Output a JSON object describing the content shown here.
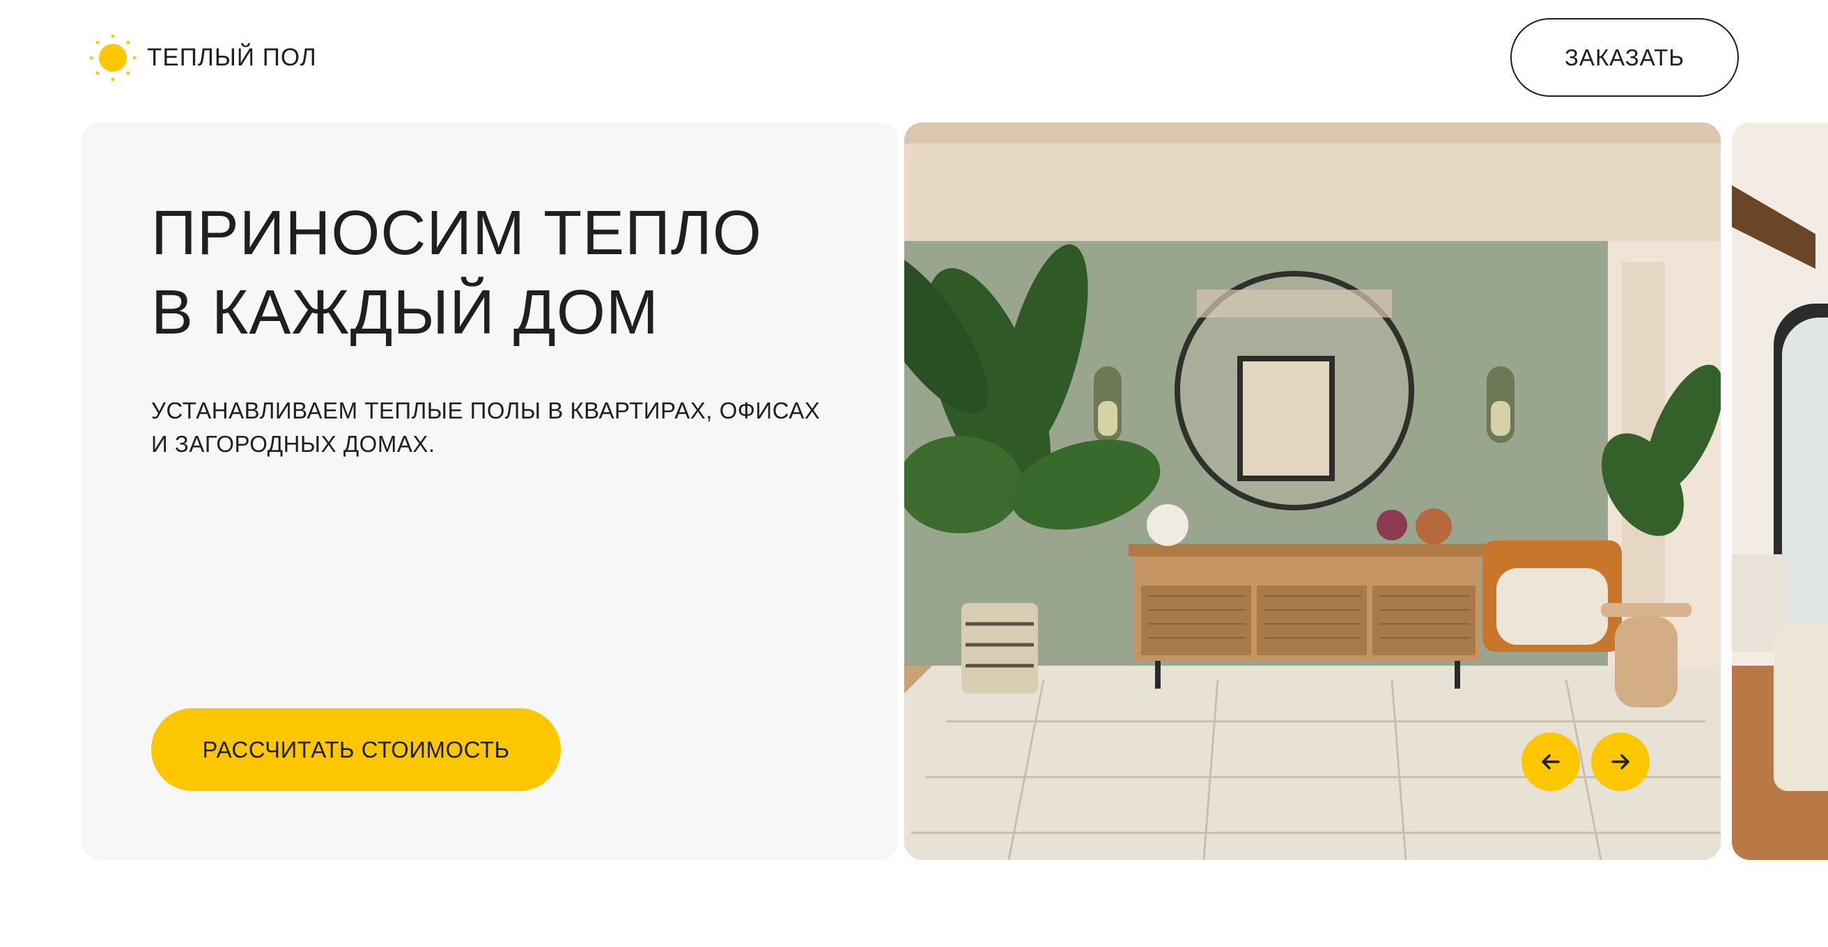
{
  "header": {
    "logo_text": "ТЕПЛЫЙ ПОЛ",
    "logo_icon": "sun-icon",
    "order_label": "ЗАКАЗАТЬ"
  },
  "hero": {
    "title_line1": "ПРИНОСИМ ТЕПЛО",
    "title_line2": "В КАЖДЫЙ ДОМ",
    "subtitle_line1": "УСТАНАВЛИВАЕМ ТЕПЛЫЕ ПОЛЫ В КВАРТИРАХ, ОФИСАХ",
    "subtitle_line2": "И ЗАГОРОДНЫХ ДОМАХ.",
    "cta_label": "РАССЧИТАТЬ СТОИМОСТЬ"
  },
  "slider": {
    "prev_icon": "arrow-left-icon",
    "next_icon": "arrow-right-icon"
  },
  "colors": {
    "accent": "#fdc700",
    "card_bg": "#f7f7f7",
    "text": "#1f1f1f"
  }
}
